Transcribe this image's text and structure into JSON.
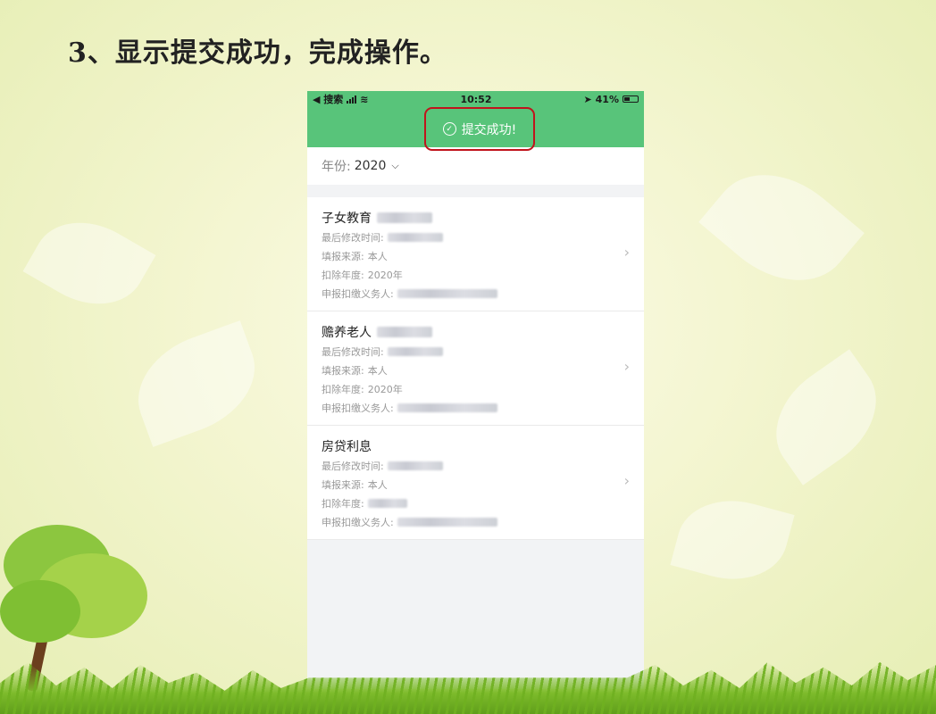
{
  "slide": {
    "title": "3、显示提交成功，完成操作。"
  },
  "status_bar": {
    "back": "◀ 搜索",
    "time": "10:52",
    "battery": "41%"
  },
  "toast": {
    "text": "提交成功!"
  },
  "year_filter": {
    "label": "年份:",
    "value": "2020"
  },
  "cards": [
    {
      "title": "子女教育",
      "rows": [
        {
          "label": "最后修改时间:",
          "value": ""
        },
        {
          "label": "填报来源:",
          "value": "本人"
        },
        {
          "label": "扣除年度:",
          "value": "2020年"
        },
        {
          "label": "申报扣缴义务人:",
          "value": ""
        }
      ]
    },
    {
      "title": "赡养老人",
      "rows": [
        {
          "label": "最后修改时间:",
          "value": ""
        },
        {
          "label": "填报来源:",
          "value": "本人"
        },
        {
          "label": "扣除年度:",
          "value": "2020年"
        },
        {
          "label": "申报扣缴义务人:",
          "value": ""
        }
      ]
    },
    {
      "title": "房贷利息",
      "rows": [
        {
          "label": "最后修改时间:",
          "value": ""
        },
        {
          "label": "填报来源:",
          "value": "本人"
        },
        {
          "label": "扣除年度:",
          "value": ""
        },
        {
          "label": "申报扣缴义务人:",
          "value": ""
        }
      ]
    }
  ],
  "colors": {
    "header_green": "#58c47a",
    "highlight_red": "#c0141c"
  }
}
